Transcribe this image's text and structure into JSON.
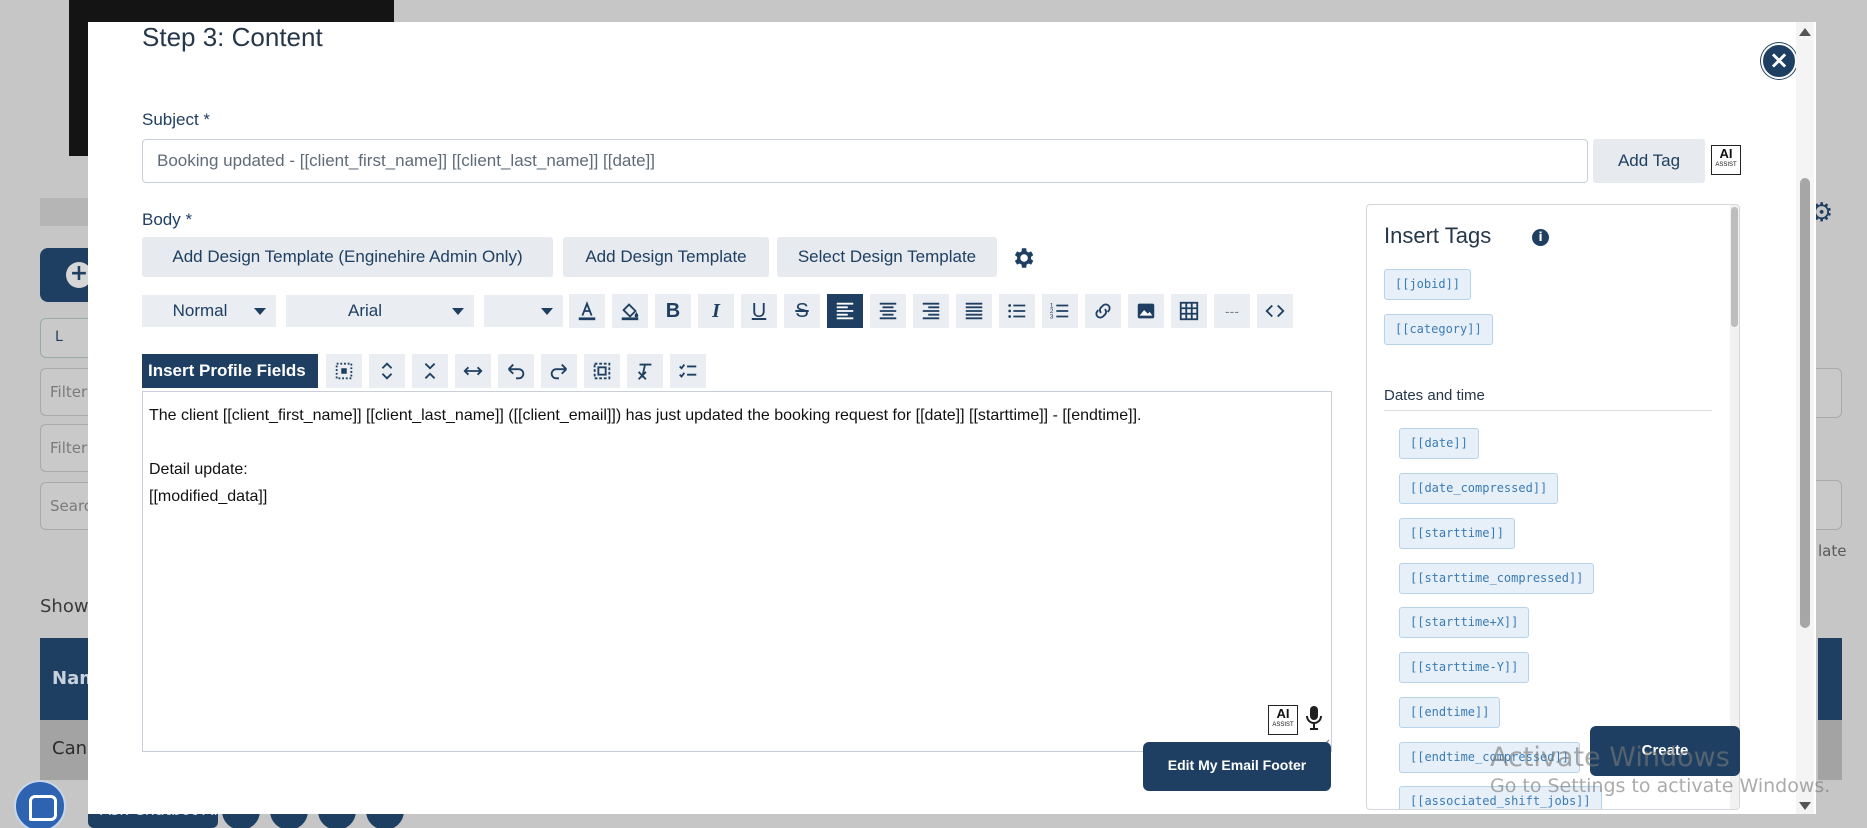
{
  "background": {
    "show_label": "Show",
    "filter_placeholder_1": "Filter",
    "filter_placeholder_2": "Filter",
    "search_placeholder": "Search",
    "pill_label": "L",
    "table_header": "Name",
    "table_row": "Cancel",
    "right_text": "late",
    "bottom_bar_label": "Ask Chatbot AI"
  },
  "modal": {
    "title": "Step 3: Content",
    "close_icon": "close-icon",
    "subject": {
      "label": "Subject *",
      "value": "Booking updated - [[client_first_name]] [[client_last_name]] [[date]]",
      "add_tag_label": "Add Tag",
      "ai_label": "AI",
      "ai_sub": "ASSIST"
    },
    "body": {
      "label": "Body *",
      "template_buttons": [
        "Add Design Template (Enginehire Admin Only)",
        "Add Design Template",
        "Select Design Template"
      ],
      "settings_icon": "gear-icon"
    },
    "toolbar": {
      "format_value": "Normal",
      "font_value": "Arial",
      "size_value": "",
      "insert_profile_label": "Insert Profile Fields",
      "hr_glyph": "---"
    },
    "editor": {
      "lines": [
        "The client [[client_first_name]] [[client_last_name]] ([[client_email]]) has just updated the booking request for [[date]] [[starttime]] - [[endtime]].",
        "",
        "Detail update:",
        "[[modified_data]]"
      ],
      "ai_label": "AI",
      "ai_sub": "ASSIST"
    },
    "edit_footer_label": "Edit My Email Footer",
    "create_label": "Create"
  },
  "tags_panel": {
    "title": "Insert Tags",
    "top_tags": [
      "[[jobid]]",
      "[[category]]"
    ],
    "section_title": "Dates and time",
    "date_tags": [
      "[[date]]",
      "[[date_compressed]]",
      "[[starttime]]",
      "[[starttime_compressed]]",
      "[[starttime+X]]",
      "[[starttime-Y]]",
      "[[endtime]]",
      "[[endtime_compressed]]",
      "[[associated_shift_jobs]]"
    ]
  },
  "watermark": {
    "line1": "Activate Windows",
    "line2": "Go to Settings to activate Windows."
  },
  "colors": {
    "primary": "#1f3f62",
    "tag_bg": "#e7f0f8",
    "tag_text": "#3b7bb5",
    "button_grey": "#e7eaee"
  }
}
